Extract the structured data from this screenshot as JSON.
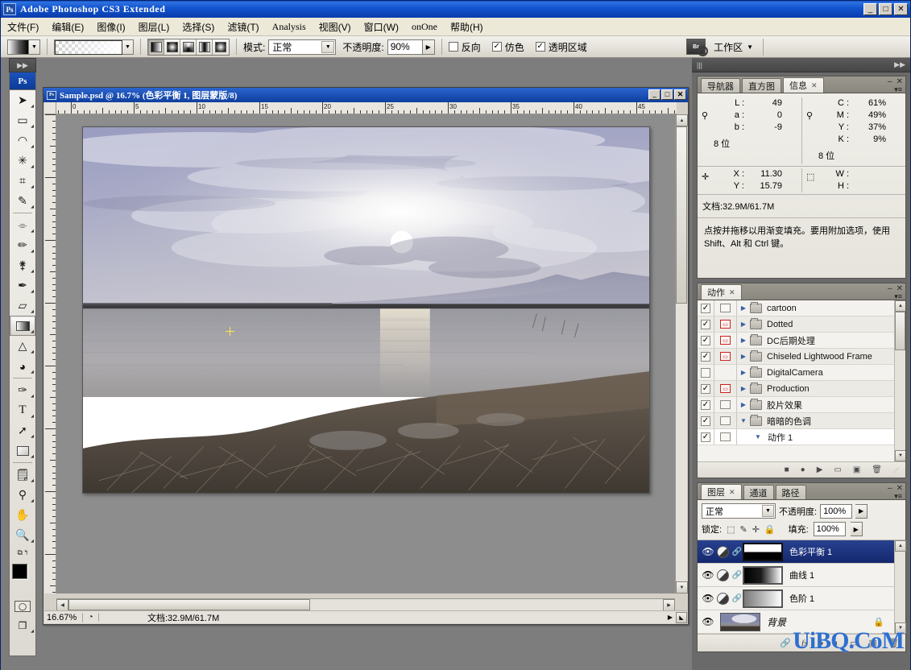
{
  "window": {
    "title": "Adobe Photoshop CS3 Extended",
    "app_badge": "Ps",
    "minimize": "_",
    "maximize": "□",
    "close": "✕"
  },
  "menubar": {
    "items": [
      {
        "label": "文件(F)"
      },
      {
        "label": "编辑(E)"
      },
      {
        "label": "图像(I)"
      },
      {
        "label": "图层(L)"
      },
      {
        "label": "选择(S)"
      },
      {
        "label": "滤镜(T)"
      },
      {
        "label": "Analysis"
      },
      {
        "label": "视图(V)"
      },
      {
        "label": "窗口(W)"
      },
      {
        "label": "onOne"
      },
      {
        "label": "帮助(H)"
      }
    ]
  },
  "options_bar": {
    "mode_label": "模式:",
    "mode_value": "正常",
    "opacity_label": "不透明度:",
    "opacity_value": "90%",
    "reverse_label": "反向",
    "reverse_checked": false,
    "dither_label": "仿色",
    "dither_checked": true,
    "transparency_label": "透明区域",
    "transparency_checked": true,
    "bridge_label": "Br",
    "workspace_label": "工作区",
    "gradient_types": [
      "linear-gradient-icon",
      "radial-gradient-icon",
      "angle-gradient-icon",
      "reflected-gradient-icon",
      "diamond-gradient-icon"
    ]
  },
  "toolbox": {
    "badge": "Ps",
    "tools": [
      {
        "name": "move-tool",
        "glyph": "➤"
      },
      {
        "name": "marquee-tool",
        "glyph": "▭"
      },
      {
        "name": "lasso-tool",
        "glyph": "◠"
      },
      {
        "name": "magic-wand-tool",
        "glyph": "✳"
      },
      {
        "name": "crop-tool",
        "glyph": "⌗"
      },
      {
        "name": "slice-tool",
        "glyph": "✎"
      },
      {
        "name": "healing-brush-tool",
        "glyph": "⌯"
      },
      {
        "name": "brush-tool",
        "glyph": "✏"
      },
      {
        "name": "clone-stamp-tool",
        "glyph": "⚷"
      },
      {
        "name": "history-brush-tool",
        "glyph": "✒"
      },
      {
        "name": "eraser-tool",
        "glyph": "▱"
      },
      {
        "name": "gradient-tool",
        "glyph": "▦",
        "selected": true
      },
      {
        "name": "dodge-tool",
        "glyph": "△"
      },
      {
        "name": "blur-tool",
        "glyph": "◕"
      },
      {
        "name": "pen-tool",
        "glyph": "✑"
      },
      {
        "name": "type-tool",
        "glyph": "T"
      },
      {
        "name": "path-selection-tool",
        "glyph": "➚"
      },
      {
        "name": "rectangle-shape-tool",
        "glyph": "▢"
      },
      {
        "name": "notes-tool",
        "glyph": "🗒"
      },
      {
        "name": "eyedropper-tool",
        "glyph": "⚲"
      },
      {
        "name": "hand-tool",
        "glyph": "✋"
      },
      {
        "name": "zoom-tool",
        "glyph": "🔍"
      }
    ],
    "foreground_color": "#000000",
    "background_color": "#ffffff",
    "quickmask_label": "◯",
    "screenmode_label": "❐"
  },
  "document": {
    "title": "Sample.psd @ 16.7%  (色彩平衡 1,  图层蒙版/8)",
    "zoom": "16.67%",
    "status_doc": "文档:32.9M/61.7M",
    "ruler_h_labels": [
      "0",
      "5",
      "10",
      "15",
      "20",
      "25",
      "30",
      "35",
      "40",
      "45"
    ],
    "minimize": "_",
    "maximize": "□",
    "close": "✕"
  },
  "info_panel": {
    "tabs": [
      {
        "label": "导航器",
        "active": false
      },
      {
        "label": "直方图",
        "active": false
      },
      {
        "label": "信息",
        "active": true
      }
    ],
    "lab": [
      {
        "key": "L :",
        "value": "49"
      },
      {
        "key": "a :",
        "value": "0"
      },
      {
        "key": "b :",
        "value": "-9"
      }
    ],
    "cmyk": [
      {
        "key": "C :",
        "value": "61%"
      },
      {
        "key": "M :",
        "value": "49%"
      },
      {
        "key": "Y :",
        "value": "37%"
      },
      {
        "key": "K :",
        "value": "9%"
      }
    ],
    "bits_left": "8 位",
    "bits_right": "8 位",
    "coords": [
      {
        "key": "X :",
        "value": "11.30"
      },
      {
        "key": "Y :",
        "value": "15.79"
      }
    ],
    "dims": [
      {
        "key": "W :",
        "value": ""
      },
      {
        "key": "H :",
        "value": ""
      }
    ],
    "doc_size": "文档:32.9M/61.7M",
    "hint": "点按并拖移以用渐变填充。要用附加选项，使用 Shift、Alt 和 Ctrl 键。"
  },
  "actions_panel": {
    "tab": "动作",
    "rows": [
      {
        "name": "cartoon",
        "checked": true,
        "dialog": false,
        "type": "folder"
      },
      {
        "name": "Dotted",
        "checked": true,
        "dialog": true,
        "type": "folder"
      },
      {
        "name": "DC后期处理",
        "checked": true,
        "dialog": true,
        "type": "folder"
      },
      {
        "name": "Chiseled Lightwood Frame",
        "checked": true,
        "dialog": true,
        "type": "folder"
      },
      {
        "name": "DigitalCamera",
        "checked": false,
        "dialog": false,
        "type": "folder"
      },
      {
        "name": "Production",
        "checked": true,
        "dialog": true,
        "type": "folder"
      },
      {
        "name": "胶片效果",
        "checked": true,
        "dialog": false,
        "type": "folder"
      },
      {
        "name": "暗暗的色调",
        "checked": true,
        "dialog": false,
        "type": "folder",
        "expanded": true
      },
      {
        "name": "动作 1",
        "checked": true,
        "dialog": false,
        "type": "action",
        "expanded": true
      }
    ],
    "footer_icons": [
      "stop-icon",
      "record-icon",
      "play-icon",
      "new-set-icon",
      "new-action-icon",
      "delete-icon"
    ]
  },
  "layers_panel": {
    "tabs": [
      {
        "label": "图层",
        "active": true
      },
      {
        "label": "通道",
        "active": false
      },
      {
        "label": "路径",
        "active": false
      }
    ],
    "blend_mode": "正常",
    "opacity_label": "不透明度:",
    "opacity_value": "100%",
    "lock_label": "锁定:",
    "fill_label": "填充:",
    "fill_value": "100%",
    "lock_icons": [
      "lock-transparent-icon",
      "lock-pixels-icon",
      "lock-position-icon",
      "lock-all-icon"
    ],
    "layers": [
      {
        "name": "色彩平衡 1",
        "active": true,
        "kind": "adjustment",
        "mask": "white-black",
        "visible": true
      },
      {
        "name": "曲线 1",
        "active": false,
        "kind": "adjustment",
        "mask": "black-white",
        "visible": true
      },
      {
        "name": "色阶 1",
        "active": false,
        "kind": "adjustment",
        "mask": "gray-white",
        "visible": true
      },
      {
        "name": "背景",
        "active": false,
        "kind": "image",
        "locked": true,
        "visible": true
      }
    ],
    "footer_icons": [
      "link-icon",
      "fx-icon",
      "mask-icon",
      "group-icon",
      "adjustment-icon",
      "new-layer-icon",
      "delete-icon"
    ]
  },
  "watermark": "UiBQ.CoM",
  "colors": {
    "titlebar_blue": "#0a3fb0",
    "selection_blue": "#1b3a8a",
    "panel_bg": "#ece9d8",
    "dock_bg": "#6a6a6a",
    "watermark_blue": "#2f6fd0"
  }
}
